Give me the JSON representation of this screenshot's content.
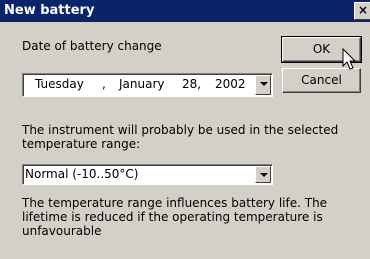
{
  "window": {
    "title": "New battery",
    "close_glyph": "×"
  },
  "date": {
    "label": "Date of battery change",
    "weekday": "Tuesday",
    "sep": ",",
    "month": "January",
    "day": "28,",
    "year": "2002"
  },
  "buttons": {
    "ok": "OK",
    "cancel": "Cancel"
  },
  "temperature": {
    "description": "The instrument will probably be used in the selected temperature range:",
    "selected": "Normal (-10..50°C)"
  },
  "note": "The temperature range influences battery life. The lifetime is reduced if the operating temperature is unfavourable"
}
